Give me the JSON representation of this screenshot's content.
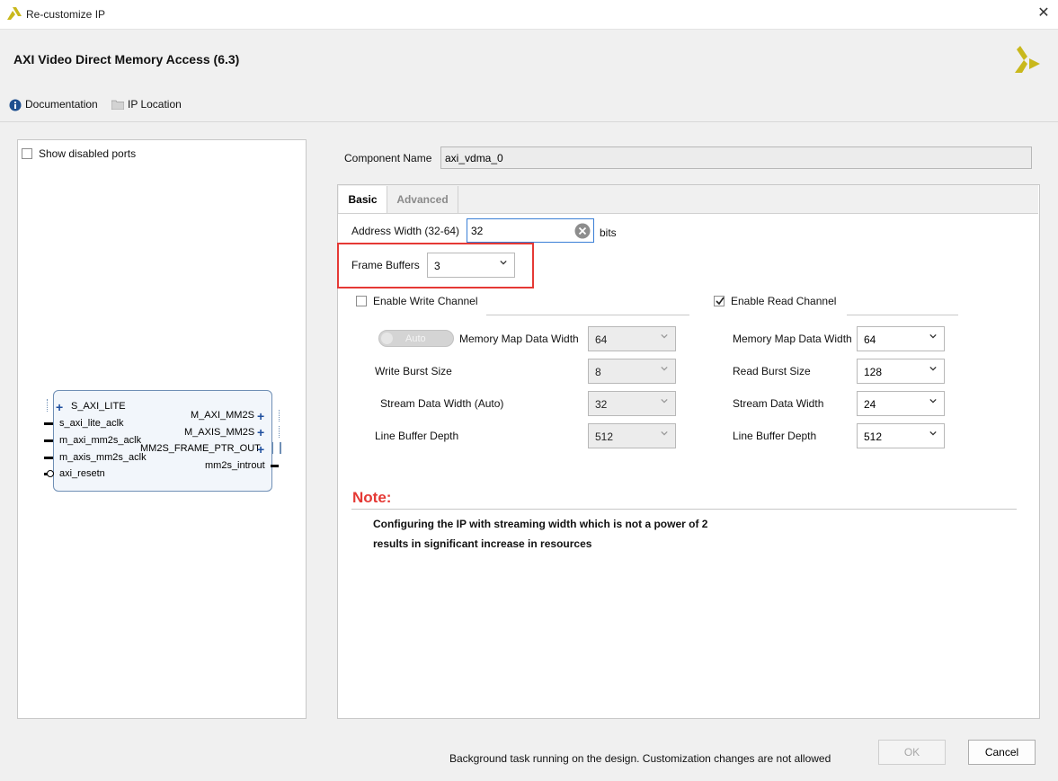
{
  "window": {
    "title": "Re-customize IP",
    "close": "✕"
  },
  "header": {
    "ip_title": "AXI Video Direct Memory Access (6.3)",
    "documentation_label": "Documentation",
    "ip_location_label": "IP Location"
  },
  "left": {
    "show_disabled_ports_label": "Show disabled ports",
    "block": {
      "left_ports": [
        "S_AXI_LITE",
        "s_axi_lite_aclk",
        "m_axi_mm2s_aclk",
        "m_axis_mm2s_aclk",
        "axi_resetn"
      ],
      "right_ports": [
        "M_AXI_MM2S",
        "M_AXIS_MM2S",
        "MM2S_FRAME_PTR_OUT",
        "mm2s_introut"
      ]
    }
  },
  "component": {
    "label": "Component Name",
    "value": "axi_vdma_0"
  },
  "tabs": {
    "basic": "Basic",
    "advanced": "Advanced"
  },
  "basic": {
    "address_width_label": "Address Width (32-64)",
    "address_width_value": "32",
    "bits_label": "bits",
    "frame_buffers_label": "Frame Buffers",
    "frame_buffers_value": "3",
    "write": {
      "enable_label": "Enable Write Channel",
      "enabled": false,
      "auto_label": "Auto",
      "mm_width_label": "Memory Map Data Width",
      "mm_width_value": "64",
      "burst_label": "Write Burst Size",
      "burst_value": "8",
      "stream_label": "Stream Data Width (Auto)",
      "stream_value": "32",
      "line_label": "Line Buffer Depth",
      "line_value": "512"
    },
    "read": {
      "enable_label": "Enable Read Channel",
      "enabled": true,
      "mm_width_label": "Memory Map Data Width",
      "mm_width_value": "64",
      "burst_label": "Read Burst Size",
      "burst_value": "128",
      "stream_label": "Stream Data Width",
      "stream_value": "24",
      "line_label": "Line Buffer Depth",
      "line_value": "512"
    },
    "note_title": "Note:",
    "note_line1": "Configuring the IP with streaming width which is not a power of 2",
    "note_line2": "results in significant increase in resources"
  },
  "footer": {
    "status": "Background task running on the design. Customization changes are not allowed",
    "ok_label": "OK",
    "cancel_label": "Cancel"
  },
  "colors": {
    "highlight_box": "#e53935",
    "note_red": "#e53935",
    "focus_blue": "#3a7fd6"
  }
}
